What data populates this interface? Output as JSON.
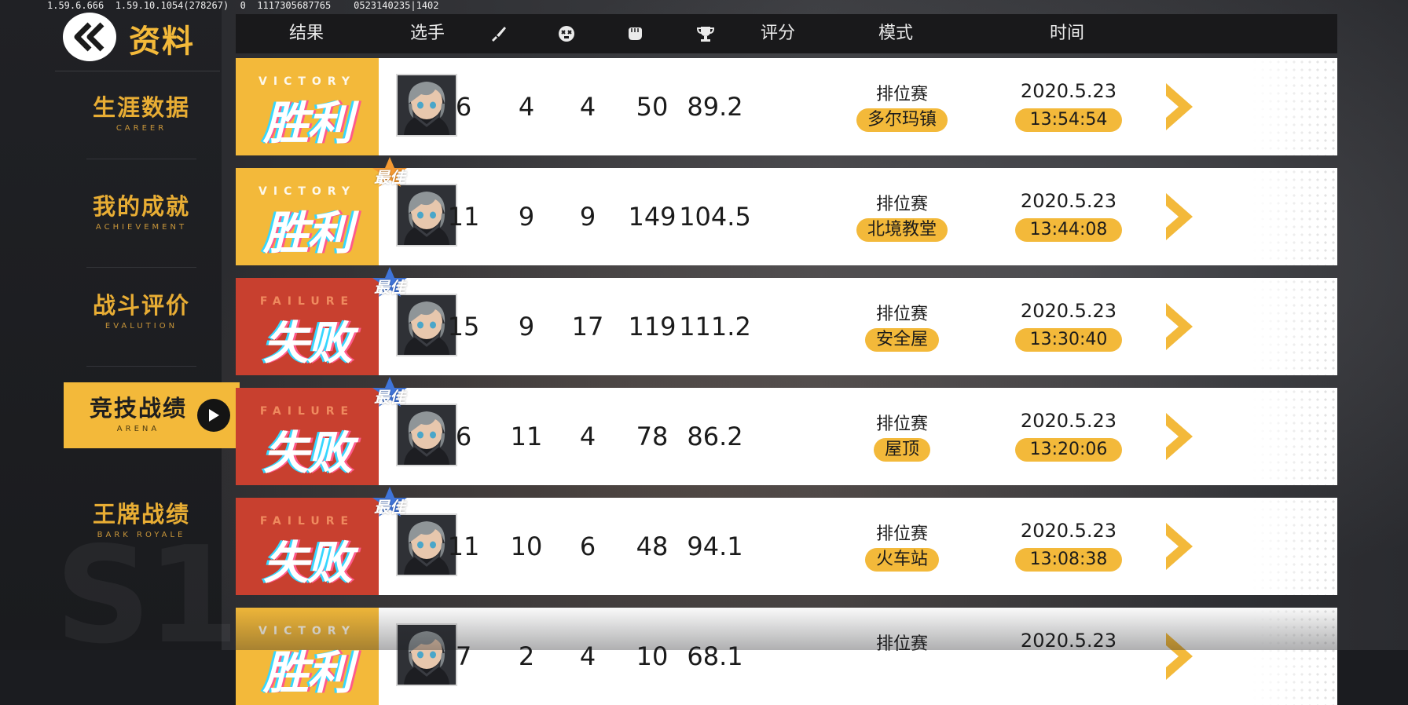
{
  "debug_text": "1.59.6.666  1.59.10.1054(278267)  0  1117305687765    0523140235|1402",
  "header": {
    "title": "资料"
  },
  "sidebar": {
    "items": [
      {
        "zh": "生涯数据",
        "en": "CAREER"
      },
      {
        "zh": "我的成就",
        "en": "ACHIEVEMENT"
      },
      {
        "zh": "战斗评价",
        "en": "EVALUTION"
      },
      {
        "zh": "竞技战绩",
        "en": "ARENA",
        "active": true
      },
      {
        "zh": "王牌战绩",
        "en": "BARK ROYALE"
      }
    ]
  },
  "table": {
    "headers": {
      "result": "结果",
      "player": "选手",
      "kills_icon": "knife-icon",
      "deaths_icon": "skull-icon",
      "assists_icon": "fist-icon",
      "trophy_icon": "trophy-icon",
      "score": "评分",
      "mode": "模式",
      "time": "时间"
    },
    "best_badge": "最佳",
    "rows": [
      {
        "result": "victory",
        "result_en": "VICTORY",
        "result_zh": "胜利",
        "best": false,
        "kills": "6",
        "deaths": "4",
        "assists": "4",
        "trophies": "50",
        "score": "89.2",
        "mode": "排位赛",
        "map": "多尔玛镇",
        "date": "2020.5.23",
        "time": "13:54:54"
      },
      {
        "result": "victory",
        "result_en": "VICTORY",
        "result_zh": "胜利",
        "best": true,
        "kills": "11",
        "deaths": "9",
        "assists": "9",
        "trophies": "149",
        "score": "104.5",
        "mode": "排位赛",
        "map": "北境教堂",
        "date": "2020.5.23",
        "time": "13:44:08"
      },
      {
        "result": "failure",
        "result_en": "FAILURE",
        "result_zh": "失败",
        "best": true,
        "kills": "15",
        "deaths": "9",
        "assists": "17",
        "trophies": "119",
        "score": "111.2",
        "mode": "排位赛",
        "map": "安全屋",
        "date": "2020.5.23",
        "time": "13:30:40"
      },
      {
        "result": "failure",
        "result_en": "FAILURE",
        "result_zh": "失败",
        "best": true,
        "kills": "6",
        "deaths": "11",
        "assists": "4",
        "trophies": "78",
        "score": "86.2",
        "mode": "排位赛",
        "map": "屋顶",
        "date": "2020.5.23",
        "time": "13:20:06"
      },
      {
        "result": "failure",
        "result_en": "FAILURE",
        "result_zh": "失败",
        "best": true,
        "kills": "11",
        "deaths": "10",
        "assists": "6",
        "trophies": "48",
        "score": "94.1",
        "mode": "排位赛",
        "map": "火车站",
        "date": "2020.5.23",
        "time": "13:08:38"
      },
      {
        "result": "victory",
        "result_en": "VICTORY",
        "result_zh": "胜利",
        "best": false,
        "kills": "7",
        "deaths": "2",
        "assists": "4",
        "trophies": "10",
        "score": "68.1",
        "mode": "排位赛",
        "map": "",
        "date": "2020.5.23",
        "time": ""
      }
    ]
  },
  "colors": {
    "accent": "#f3b93a",
    "failure": "#c8402f",
    "best_victory_badge": "#f59a32",
    "best_failure_badge": "#3f74d9",
    "header_bar": "#19191b"
  }
}
